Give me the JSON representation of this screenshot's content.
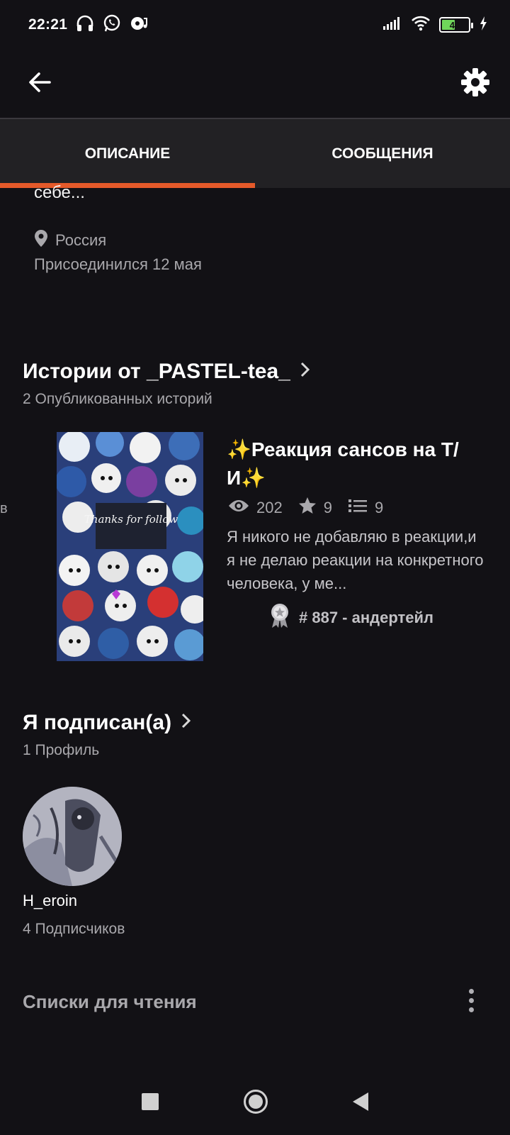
{
  "status_bar": {
    "time": "22:21",
    "battery_level": "44"
  },
  "header": {
    "back_icon": "arrow-left-icon",
    "settings_icon": "gear-icon"
  },
  "tabs": [
    {
      "label": "ОПИСАНИЕ",
      "active": true
    },
    {
      "label": "СООБЩЕНИЯ",
      "active": false
    }
  ],
  "profile": {
    "about_snippet": "себе...",
    "location": "Россия",
    "joined": "Присоединился 12 мая"
  },
  "stories_section": {
    "title": "Истории от _PASTEL-tea_",
    "subtitle": "2 Опубликованных историй",
    "story": {
      "title": "✨Реакция сансов на Т/И✨",
      "views": "202",
      "votes": "9",
      "parts": "9",
      "description": "Я никого не добавляю в реакции,и я не делаю реакции на конкретного человека, у ме...",
      "rank": "# 887 - андертейл",
      "cover_text": "Thanks for follow"
    }
  },
  "following_section": {
    "title": "Я подписан(а)",
    "subtitle": "1 Профиль",
    "user": {
      "name": "H_eroin",
      "followers": "4 Подписчиков"
    }
  },
  "reading_lists": {
    "title": "Списки для чтения"
  },
  "colors": {
    "accent": "#e55a2a",
    "background": "#121115",
    "tab_bar": "#222124"
  }
}
